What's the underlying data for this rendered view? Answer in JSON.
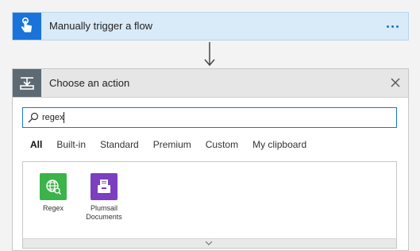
{
  "trigger": {
    "title": "Manually trigger a flow",
    "icon": "hand-tap-icon",
    "accent": "#1a73d9"
  },
  "action_picker": {
    "title": "Choose an action",
    "icon": "action-step-icon",
    "search": {
      "value": "regex"
    },
    "tabs": [
      {
        "label": "All",
        "active": true
      },
      {
        "label": "Built-in",
        "active": false
      },
      {
        "label": "Standard",
        "active": false
      },
      {
        "label": "Premium",
        "active": false
      },
      {
        "label": "Custom",
        "active": false
      },
      {
        "label": "My clipboard",
        "active": false
      }
    ],
    "connectors": [
      {
        "label": "Regex",
        "color": "#3cb34a",
        "icon": "globe-search-icon"
      },
      {
        "label": "Plumsail Documents",
        "color": "#7b3fbf",
        "icon": "file-drawer-icon"
      }
    ]
  }
}
